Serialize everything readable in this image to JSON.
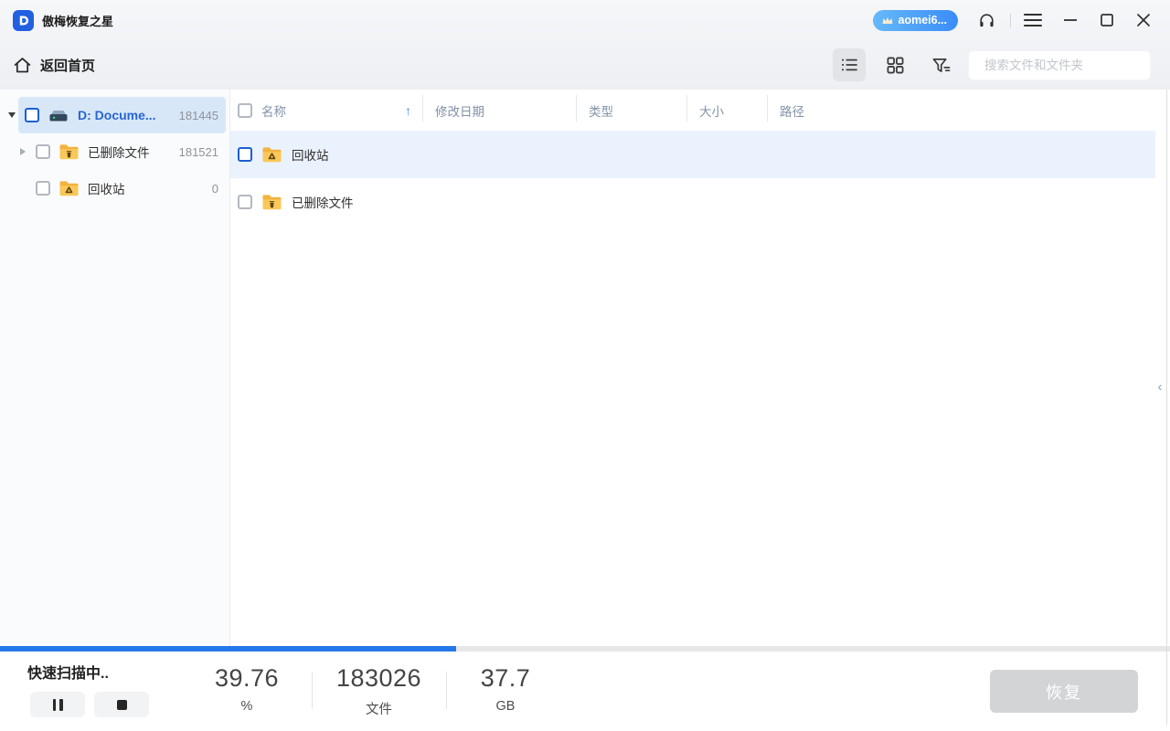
{
  "window": {
    "title": "傲梅恢复之星",
    "account_badge": "aomei6..."
  },
  "toolbar": {
    "back_home_label": "返回首页",
    "search_placeholder": "搜索文件和文件夹"
  },
  "sidebar": {
    "items": [
      {
        "label": "D: Docume...",
        "count": "181445",
        "type": "drive",
        "selected": true
      },
      {
        "label": "已删除文件",
        "count": "181521",
        "type": "folder-trash"
      },
      {
        "label": "回收站",
        "count": "0",
        "type": "folder-recycle"
      }
    ]
  },
  "table": {
    "columns": [
      "名称",
      "修改日期",
      "类型",
      "大小",
      "路径"
    ],
    "rows": [
      {
        "name": "回收站",
        "icon": "folder-recycle",
        "highlighted": true
      },
      {
        "name": "已删除文件",
        "icon": "folder-trash",
        "highlighted": false
      }
    ]
  },
  "statusbar": {
    "scanning_label": "快速扫描中..",
    "progress_ratio": 0.39,
    "stats": {
      "percent": {
        "value": "39.76",
        "unit": "%"
      },
      "files": {
        "value": "183026",
        "unit": "文件"
      },
      "size": {
        "value": "37.7",
        "unit": "GB"
      }
    },
    "recover_label": "恢复"
  },
  "icons": {
    "sort_ascending": "↑",
    "collapse_panel": "‹"
  },
  "colors": {
    "accent_blue": "#2677e8",
    "badge_gradient_start": "#66b9f8",
    "badge_gradient_end": "#3a8cf8",
    "selected_row_bg": "#d8e7f8",
    "highlight_row_bg": "#eaf2fd",
    "folder_yellow": "#f7c04a",
    "disabled_button": "#d2d4d6"
  }
}
